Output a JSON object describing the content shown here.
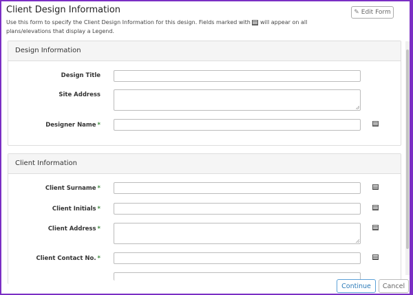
{
  "header": {
    "title": "Client Design Information",
    "subtitle_before_icon": "Use this form to specify the Client Design Information for this design. Fields marked with",
    "subtitle_after_icon": "will appear on all plans/elevations that display a Legend.",
    "edit_button_label": "Edit Form"
  },
  "design_section": {
    "heading": "Design Information",
    "fields": [
      {
        "label": "Design Title",
        "value": "",
        "required": false,
        "legend": false
      },
      {
        "label": "Site Address",
        "value": "",
        "required": false,
        "legend": false
      },
      {
        "label": "Designer Name",
        "value": "",
        "required": true,
        "legend": true
      }
    ]
  },
  "client_section": {
    "heading": "Client Information",
    "fields": [
      {
        "label": "Client Surname",
        "value": "",
        "required": true,
        "legend": true
      },
      {
        "label": "Client Initials",
        "value": "",
        "required": true,
        "legend": true
      },
      {
        "label": "Client Address",
        "value": "",
        "required": true,
        "legend": true
      },
      {
        "label": "Client Contact No.",
        "value": "",
        "required": true,
        "legend": true
      }
    ]
  },
  "required_marker": "*",
  "footer": {
    "continue_label": "Continue",
    "cancel_label": "Cancel"
  },
  "icons": {
    "legend": "legend-list-icon",
    "edit": "pencil-icon"
  },
  "colors": {
    "border": "#7b2fc4",
    "required": "#3c8a3c",
    "primary_button": "#2a7ab8"
  }
}
